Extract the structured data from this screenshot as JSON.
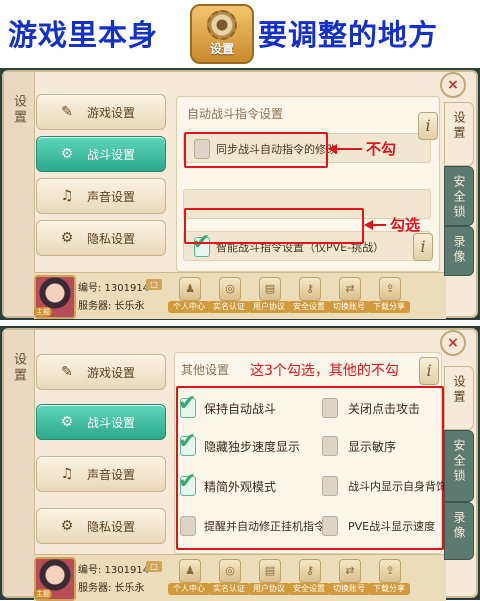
{
  "banner": {
    "left_text": "游戏里本身",
    "gear_label": "设置",
    "right_text": "要调整的地方"
  },
  "panel1": {
    "left_strip_label": "设置",
    "menu": [
      {
        "label": "游戏设置",
        "icon": "✎"
      },
      {
        "label": "战斗设置",
        "icon": "⚙"
      },
      {
        "label": "声音设置",
        "icon": "♫"
      },
      {
        "label": "隐私设置",
        "icon": "⚙"
      }
    ],
    "section_title": "自动战斗指令设置",
    "options": [
      {
        "label": "同步战斗自动指令的修改",
        "checked": false
      },
      {
        "label": "智能战斗指令设置（仅PVE-挑战）",
        "checked": true
      }
    ],
    "annotations": {
      "not_check": "不勾",
      "check": "勾选"
    },
    "info_icon": "i",
    "tabs": [
      "设置",
      "安全锁",
      "录像"
    ],
    "close": "×"
  },
  "panel2": {
    "left_strip_label": "设置",
    "menu": [
      {
        "label": "游戏设置",
        "icon": "✎"
      },
      {
        "label": "战斗设置",
        "icon": "⚙"
      },
      {
        "label": "声音设置",
        "icon": "♫"
      },
      {
        "label": "隐私设置",
        "icon": "⚙"
      }
    ],
    "section_title": "其他设置",
    "annotation": "这3个勾选，其他的不勾",
    "options": [
      {
        "label": "保持自动战斗",
        "checked": true
      },
      {
        "label": "关闭点击攻击",
        "checked": false
      },
      {
        "label": "隐藏独步速度显示",
        "checked": true
      },
      {
        "label": "显示敏序",
        "checked": false
      },
      {
        "label": "精简外观模式",
        "checked": true
      },
      {
        "label": "战斗内显示自身背饰",
        "checked": false
      },
      {
        "label": "提醒并自动修正挂机指令",
        "checked": false
      },
      {
        "label": "PVE战斗显示速度",
        "checked": false
      }
    ],
    "info_icon": "i",
    "tabs": [
      "设置",
      "安全锁",
      "录像"
    ],
    "close": "×"
  },
  "footer": {
    "id_label": "编号: 1301914",
    "server_label": "服务器: 长乐永",
    "copy": "□",
    "avatar_btn": "主题",
    "buttons": [
      "个人中心",
      "实名认证",
      "用户协议",
      "安全设置",
      "切换账号",
      "下载分享"
    ]
  },
  "colors": {
    "banner_blue": "#1530c8",
    "annotation_red": "#e0141b",
    "active_teal": "#2ea88c",
    "check_green": "#3aa870"
  }
}
